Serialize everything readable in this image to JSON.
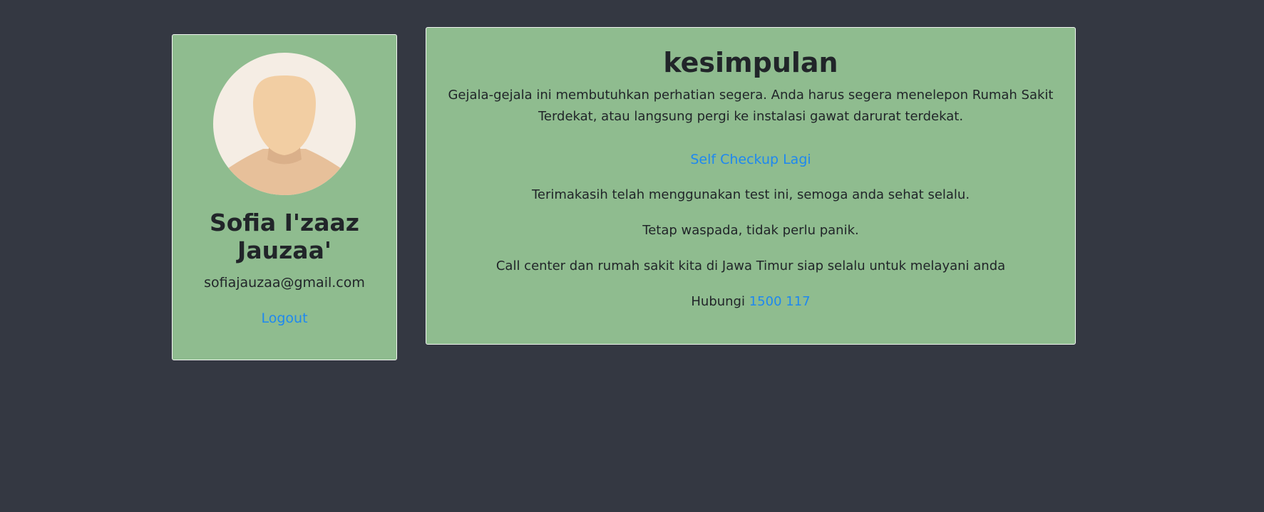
{
  "profile": {
    "name": "Sofia I'zaaz Jauzaa'",
    "email": "sofiajauzaa@gmail.com",
    "logout_label": "Logout",
    "avatar_icon": "user-silhouette-icon"
  },
  "conclusion": {
    "title": "kesimpulan",
    "message": "Gejala-gejala ini membutuhkan perhatian segera. Anda harus segera menelepon Rumah Sakit Terdekat, atau langsung pergi ke instalasi gawat darurat terdekat.",
    "recheck_label": "Self Checkup Lagi",
    "thanks": "Terimakasih telah menggunakan test ini, semoga anda sehat selalu.",
    "stay_alert": "Tetap waspada, tidak perlu panik.",
    "call_center": "Call center dan rumah sakit kita di Jawa Timur siap selalu untuk melayani anda",
    "contact_prefix": "Hubungi ",
    "contact_number": "1500 117"
  },
  "colors": {
    "page_background": "#343842",
    "card_background": "#8fbc8f",
    "link": "#1e88f0",
    "text": "#212529"
  }
}
